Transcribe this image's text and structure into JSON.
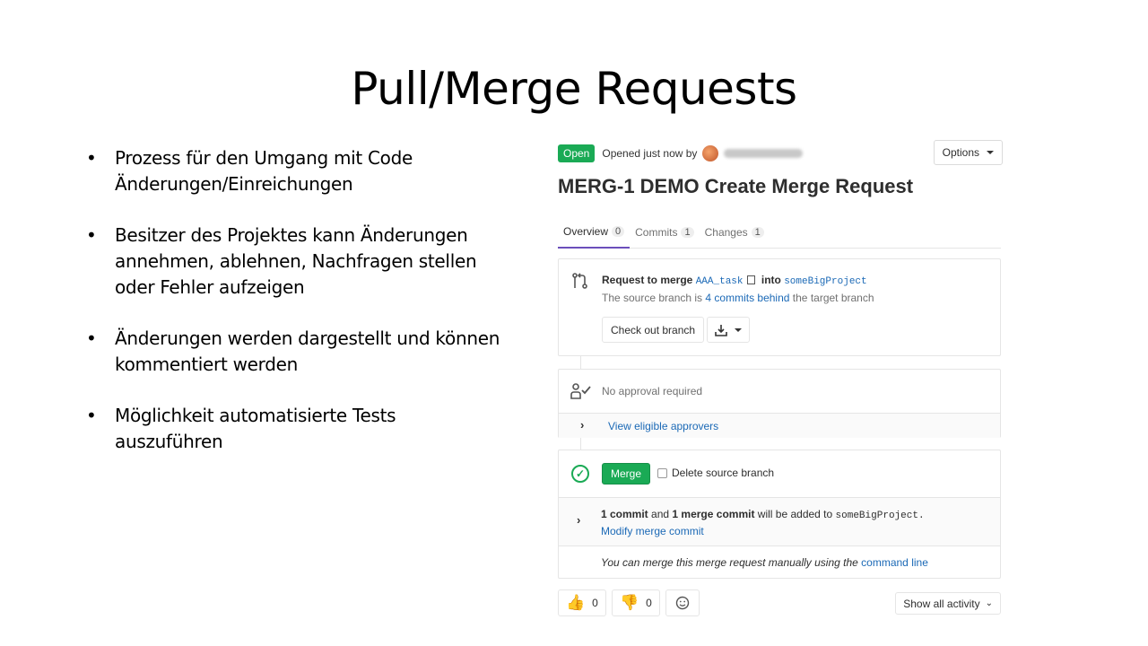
{
  "slide": {
    "title": "Pull/Merge Requests",
    "bullets": [
      "Prozess für den Umgang mit Code Änderungen/Einreichungen",
      "Besitzer des Projektes kann Änderungen annehmen, ablehnen, Nachfragen stellen oder Fehler aufzeigen",
      "Änderungen werden dargestellt und können kommentiert werden",
      "Möglichkeit automatisierte Tests auszuführen"
    ],
    "bullet_char": "•"
  },
  "mr": {
    "status": "Open",
    "opened_text": "Opened just now by",
    "options_label": "Options",
    "title": "MERG-1 DEMO Create Merge Request",
    "tabs": [
      {
        "label": "Overview",
        "count": "0"
      },
      {
        "label": "Commits",
        "count": "1"
      },
      {
        "label": "Changes",
        "count": "1"
      }
    ],
    "request": {
      "prefix": "Request to merge",
      "source": "AAA_task",
      "into": "into",
      "target": "someBigProject",
      "behind_pre": "The source branch is",
      "behind_link": "4 commits behind",
      "behind_post": "the target branch",
      "checkout_label": "Check out branch"
    },
    "approval": {
      "text": "No approval required",
      "eligible_link": "View eligible approvers"
    },
    "merge": {
      "merge_label": "Merge",
      "delete_label": "Delete source branch",
      "commit_count": "1 commit",
      "and": "and",
      "merge_commit": "1 merge commit",
      "will_be_added": "will be added to",
      "target": "someBigProject.",
      "modify_link": "Modify merge commit",
      "manual_text": "You can merge this merge request manually using the",
      "manual_link": "command line"
    },
    "reactions": {
      "thumbs_up_count": "0",
      "thumbs_down_count": "0",
      "show_activity": "Show all activity"
    }
  }
}
